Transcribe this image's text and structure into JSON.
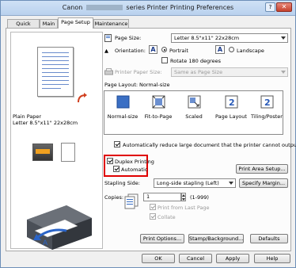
{
  "window": {
    "title_left": "Canon",
    "title_right": "series Printer Printing Preferences",
    "help": "?",
    "close": "✕"
  },
  "tabs": [
    "Quick Setup",
    "Main",
    "Page Setup",
    "Maintenance"
  ],
  "preview": {
    "media": "Plain Paper",
    "size": "Letter 8.5\"x11\" 22x28cm"
  },
  "page_size": {
    "label": "Page Size:",
    "value": "Letter 8.5\"x11\" 22x28cm"
  },
  "orientation": {
    "label": "Orientation:",
    "portrait": "Portrait",
    "landscape": "Landscape",
    "portrait_glyph": "A",
    "landscape_glyph": "A",
    "rotate": "Rotate 180 degrees"
  },
  "printer_paper_size": {
    "label": "Printer Paper Size:",
    "value": "Same as Page Size"
  },
  "page_layout": {
    "label": "Page Layout:",
    "value": "Normal-size",
    "items": [
      "Normal-size",
      "Fit-to-Page",
      "Scaled",
      "Page Layout",
      "Tiling/Poster"
    ],
    "glyph_page_layout": "2",
    "glyph_tiling": "2"
  },
  "auto_reduce": "Automatically reduce large document that the printer cannot output",
  "duplex": {
    "label": "Duplex Printing",
    "automatic": "Automatic"
  },
  "print_area": "Print Area Setup...",
  "stapling": {
    "label": "Stapling Side:",
    "value": "Long-side stapling (Left)"
  },
  "specify_margin": "Specify Margin...",
  "copies": {
    "label": "Copies:",
    "value": "1",
    "range": "(1-999)",
    "last_page": "Print from Last Page",
    "collate": "Collate"
  },
  "bottom_buttons": {
    "print_options": "Print Options...",
    "stamp": "Stamp/Background...",
    "defaults": "Defaults"
  },
  "dialog_buttons": {
    "ok": "OK",
    "cancel": "Cancel",
    "apply": "Apply",
    "help": "Help"
  },
  "colors": {
    "highlight": "#e00000",
    "accent": "#3a6fc4"
  }
}
